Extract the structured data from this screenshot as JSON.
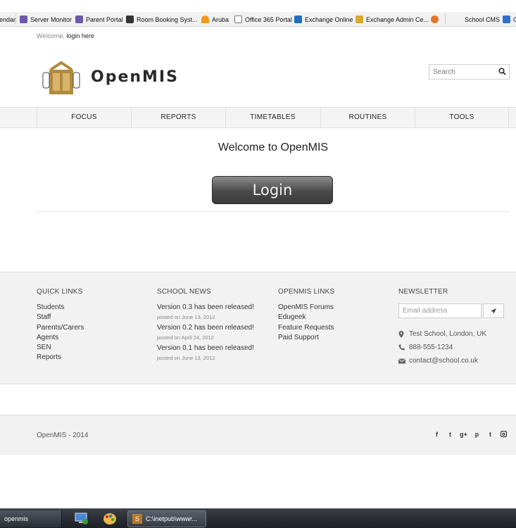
{
  "bookmarks": [
    {
      "label": "endar",
      "color": "#ffffff"
    },
    {
      "label": "Server Monitor",
      "color": "#6b58a8"
    },
    {
      "label": "Parent Portal",
      "color": "#6b58a8"
    },
    {
      "label": "Room Booking Syst...",
      "color": "#333333"
    },
    {
      "label": "Aruba",
      "color": "#f39a1e"
    },
    {
      "label": "Office 365 Portal",
      "color": "#777777"
    },
    {
      "label": "Exchange Online",
      "color": "#1f6fc2"
    },
    {
      "label": "Exchange Admin Ce...",
      "color": "#d9a92b"
    },
    {
      "label": "",
      "color": "#e2762a"
    },
    {
      "label": "School CMS",
      "color": "#ffffff"
    },
    {
      "label": "C",
      "color": "#2d6fd0"
    }
  ],
  "header": {
    "welcome_prefix": "Welcome,",
    "login_link": "login here",
    "logo_text": "OpenMIS",
    "logo_color": "#b08a3e",
    "search_placeholder": "Search"
  },
  "nav": [
    "FOCUS",
    "REPORTS",
    "TIMETABLES",
    "ROUTINES",
    "TOOLS"
  ],
  "main": {
    "title": "Welcome to OpenMIS",
    "login_label": "Login"
  },
  "footer": {
    "quick_links": {
      "heading": "QUICK LINKS",
      "items": [
        "Students",
        "Staff",
        "Parents/Carers",
        "Agents",
        "SEN",
        "Reports"
      ]
    },
    "school_news": {
      "heading": "SCHOOL NEWS",
      "items": [
        {
          "title": "Version 0.3 has been released!",
          "date": "posted on June 13, 2012"
        },
        {
          "title": "Version 0.2 has been released!",
          "date": "posted on April 24, 2012"
        },
        {
          "title": "Version 0.1 has been released!",
          "date": "posted on June 13, 2012"
        }
      ]
    },
    "openmis_links": {
      "heading": "OPENMIS LINKS",
      "items": [
        "OpenMIS Forums",
        "Edugeek",
        "Feature Requests",
        "Paid Support"
      ]
    },
    "newsletter": {
      "heading": "NEWSLETTER",
      "placeholder": "Email address",
      "address": "Test School, London, UK",
      "phone": "888-555-1234",
      "email": "contact@school.co.uk"
    }
  },
  "bottom": {
    "copyright": "OpenMIS - 2014",
    "social": [
      "f",
      "t",
      "g+",
      "p",
      "t",
      "ig"
    ]
  },
  "taskbar": {
    "start_label": "openmis",
    "window_label": "C:\\inetpub\\wwwr..."
  }
}
